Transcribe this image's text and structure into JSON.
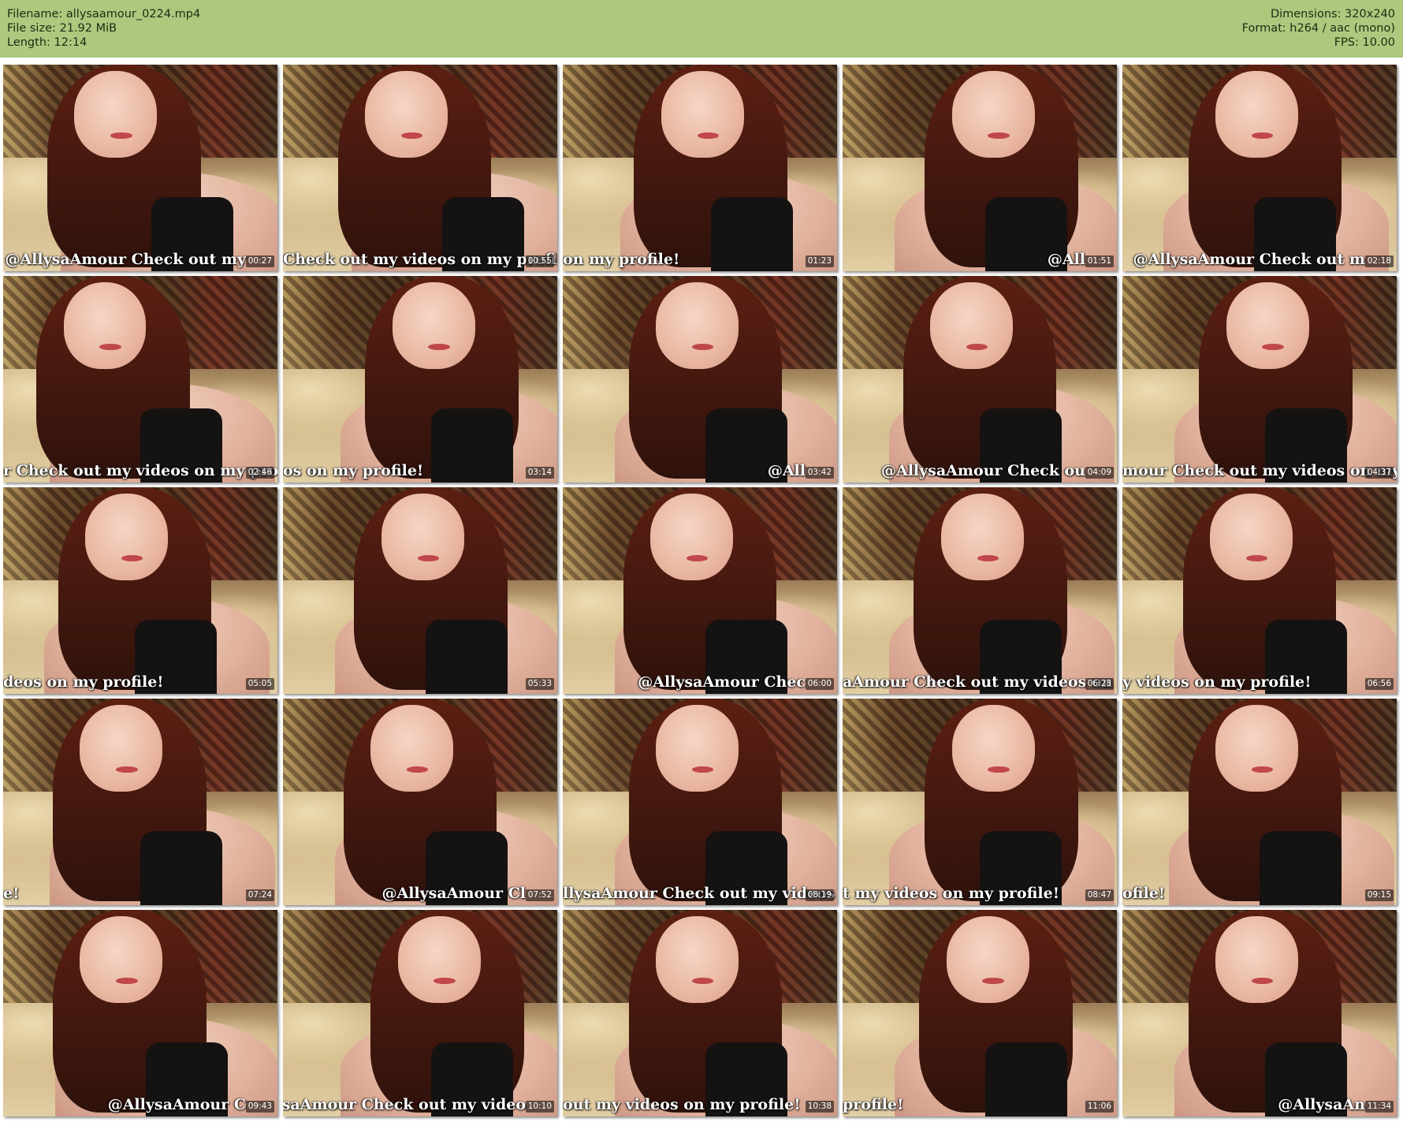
{
  "header": {
    "filename": "Filename: allysaamour_0224.mp4",
    "file_size": "File size: 21.92 MiB",
    "length": "Length: 12:14",
    "dimensions": "Dimensions: 320x240",
    "format": "Format: h264 / aac (mono)",
    "fps": "FPS: 10.00"
  },
  "colors": {
    "header_bg": "#acc97e",
    "page_bg": "#ffffff"
  },
  "thumbnails": [
    {
      "time": "00:27",
      "caption": "@AllysaAmour Check out my"
    },
    {
      "time": "00:55",
      "caption": "Check out my videos on my profile!"
    },
    {
      "time": "01:23",
      "caption": "on my profile!"
    },
    {
      "time": "01:51",
      "caption": "@All"
    },
    {
      "time": "02:18",
      "caption": "@AllysaAmour Check out m"
    },
    {
      "time": "02:46",
      "caption": "r Check out my videos on my profil"
    },
    {
      "time": "03:14",
      "caption": "os on my profile!"
    },
    {
      "time": "03:42",
      "caption": "@All"
    },
    {
      "time": "04:09",
      "caption": "@AllysaAmour Check ou"
    },
    {
      "time": "04:37",
      "caption": "mour Check out my videos on my pr"
    },
    {
      "time": "05:05",
      "caption": "deos on my profile!"
    },
    {
      "time": "05:33",
      "caption": ""
    },
    {
      "time": "06:00",
      "caption": "@AllysaAmour Chec"
    },
    {
      "time": "06:28",
      "caption": "aAmour Check out my videos on my"
    },
    {
      "time": "06:56",
      "caption": "y videos on my profile!"
    },
    {
      "time": "07:24",
      "caption": "e!"
    },
    {
      "time": "07:52",
      "caption": "@AllysaAmour Cl"
    },
    {
      "time": "08:19",
      "caption": "llysaAmour Check out my videos on"
    },
    {
      "time": "08:47",
      "caption": "t my videos on my profile!"
    },
    {
      "time": "09:15",
      "caption": "ofile!"
    },
    {
      "time": "09:43",
      "caption": "@AllysaAmour C"
    },
    {
      "time": "10:10",
      "caption": "@AllysaAmour Check out my video"
    },
    {
      "time": "10:38",
      "caption": "out my videos on my profile!"
    },
    {
      "time": "11:06",
      "caption": "profile!"
    },
    {
      "time": "11:34",
      "caption": "@AllysaAn"
    }
  ]
}
